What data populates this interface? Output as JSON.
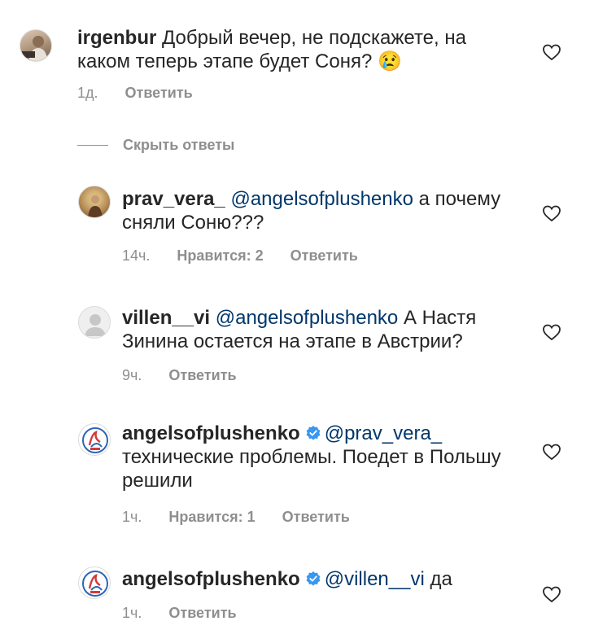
{
  "comments": [
    {
      "username": "irgenbur",
      "mention": "",
      "text": "Добрый вечер, не подскажете, на каком теперь этапе будет Соня? 😢",
      "time": "1д.",
      "likes": "",
      "reply_label": "Ответить",
      "verified": false
    },
    {
      "username": "prav_vera_",
      "mention": "@angelsofplushenko",
      "text": "а почему сняли Соню???",
      "time": "14ч.",
      "likes": "Нравится: 2",
      "reply_label": "Ответить",
      "verified": false
    },
    {
      "username": "villen__vi",
      "mention": "@angelsofplushenko",
      "text": "А Настя Зинина остается на этапе в Австрии?",
      "time": "9ч.",
      "likes": "",
      "reply_label": "Ответить",
      "verified": false
    },
    {
      "username": "angelsofplushenko",
      "mention": "@prav_vera_",
      "text": "технические проблемы. Поедет в Польшу решили",
      "time": "1ч.",
      "likes": "Нравится: 1",
      "reply_label": "Ответить",
      "verified": true
    },
    {
      "username": "angelsofplushenko",
      "mention": "@villen__vi",
      "text": "да",
      "time": "1ч.",
      "likes": "",
      "reply_label": "Ответить",
      "verified": true
    }
  ],
  "hide_replies_label": "Скрыть ответы",
  "colors": {
    "mention": "#00376b",
    "meta": "#8e8e8e",
    "verified": "#3897f0"
  }
}
